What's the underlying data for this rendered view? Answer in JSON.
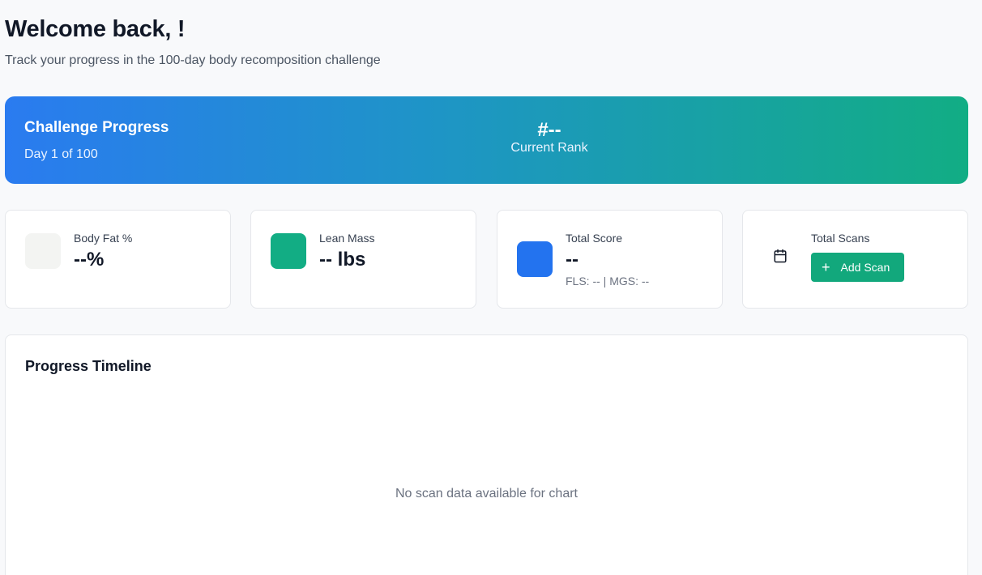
{
  "header": {
    "title": "Welcome back, !",
    "subtitle": "Track your progress in the 100-day body recomposition challenge"
  },
  "challenge": {
    "title": "Challenge Progress",
    "day_text": "Day 1 of 100",
    "rank_value": "#--",
    "rank_label": "Current Rank",
    "gradient_colors": [
      "#2a7bf0",
      "#12ad84"
    ]
  },
  "cards": {
    "body_fat": {
      "label": "Body Fat %",
      "value": "--%",
      "icon_color": "#f3f4f2"
    },
    "lean_mass": {
      "label": "Lean Mass",
      "value": "-- lbs",
      "icon_color": "#12ad84"
    },
    "total_score": {
      "label": "Total Score",
      "value": "--",
      "sub": "FLS: -- | MGS: --",
      "icon_color": "#2373ef"
    },
    "total_scans": {
      "label": "Total Scans",
      "icon": "calendar-icon",
      "button_label": "Add Scan",
      "button_icon": "plus-icon",
      "button_color": "#12a87c"
    }
  },
  "timeline": {
    "title": "Progress Timeline",
    "empty_message": "No scan data available for chart"
  }
}
